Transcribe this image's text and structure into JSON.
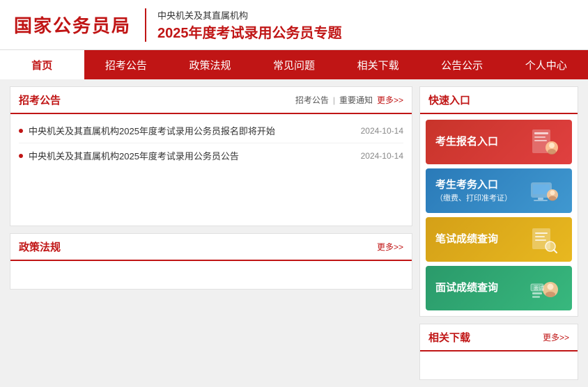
{
  "header": {
    "logo": "国家公务员局",
    "subtitle_top": "中央机关及其直属机构",
    "subtitle_bottom": "2025年度考试录用公务员专题"
  },
  "nav": {
    "items": [
      {
        "label": "首页",
        "active": true
      },
      {
        "label": "招考公告",
        "active": false
      },
      {
        "label": "政策法规",
        "active": false
      },
      {
        "label": "常见问题",
        "active": false
      },
      {
        "label": "相关下载",
        "active": false
      },
      {
        "label": "公告公示",
        "active": false
      },
      {
        "label": "个人中心",
        "active": false
      }
    ]
  },
  "announcement_section": {
    "title": "招考公告",
    "link1": "招考公告",
    "link2": "重要通知",
    "more": "更多>>",
    "items": [
      {
        "text": "中央机关及其直属机构2025年度考试录用公务员报名即将开始",
        "date": "2024-10-14"
      },
      {
        "text": "中央机关及其直属机构2025年度考试录用公务员公告",
        "date": "2024-10-14"
      }
    ]
  },
  "quick_entry": {
    "title": "快速入口",
    "items": [
      {
        "label": "考生报名入口",
        "sublabel": "",
        "color": "btn-red",
        "icon": "📋"
      },
      {
        "label": "考生考务入口",
        "sublabel": "（缴费、打印准考证）",
        "color": "btn-blue",
        "icon": "💻"
      },
      {
        "label": "笔试成绩查询",
        "sublabel": "",
        "color": "btn-yellow",
        "icon": "🔍"
      },
      {
        "label": "面试成绩查询",
        "sublabel": "",
        "color": "btn-green",
        "icon": "📝"
      }
    ]
  },
  "policy_section": {
    "title": "政策法规",
    "more": "更多>>"
  },
  "related_section": {
    "title": "相关下载",
    "more": "更多>>"
  }
}
